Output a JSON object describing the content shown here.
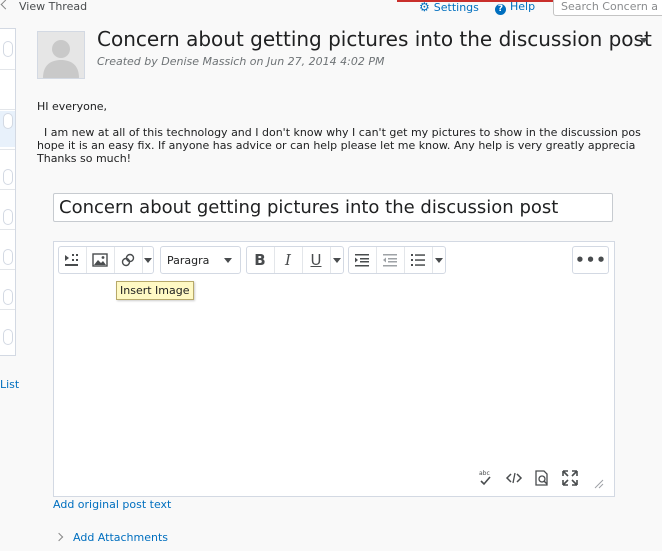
{
  "topbar": {
    "view_thread": "View Thread",
    "settings": "Settings",
    "help": "Help",
    "search_placeholder": "Search Concern a"
  },
  "leftpanel": {
    "list_link": "List"
  },
  "post": {
    "title": "Concern about getting pictures into the discussion post",
    "byline": "Created by Denise Massich on Jun 27, 2014 4:02 PM",
    "body": "HI everyone,\n\n  I am new at all of this technology and I don't know why I can't get my pictures to show in the discussion pos\nhope it is an easy fix. If anyone has advice or can help please let me know. Any help is very greatly apprecia\nThanks so much!"
  },
  "reply": {
    "subject_value": "Concern about getting pictures into the discussion post",
    "format_label": "Paragra",
    "tooltip": "Insert Image",
    "add_original": "Add original post text",
    "add_attachments": "Add Attachments"
  },
  "colors": {
    "link": "#006fbf",
    "accent": "#c9302c",
    "tooltip_bg": "#fff9c4"
  }
}
